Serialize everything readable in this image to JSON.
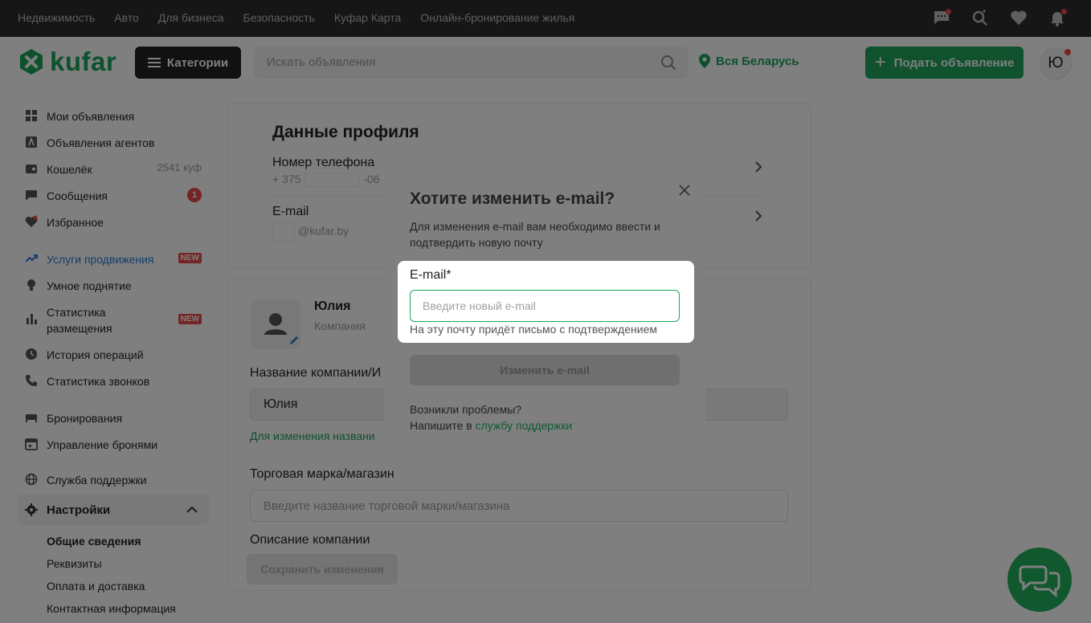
{
  "topbar": {
    "links": [
      "Недвижимость",
      "Авто",
      "Для бизнеса",
      "Безопасность",
      "Куфар Карта",
      "Онлайн-бронирование жилья"
    ]
  },
  "header": {
    "logo_text": "kufar",
    "categories_label": "Категории",
    "search_placeholder": "Искать объявления",
    "region_label": "Вся Беларусь",
    "post_button_label": "Подать объявление",
    "avatar_letter": "Ю"
  },
  "sidebar": {
    "my_ads": "Мои объявления",
    "agent_ads": "Объявления агентов",
    "wallet": "Кошелёк",
    "wallet_amount": "2541 куф",
    "messages": "Сообщения",
    "messages_count": "1",
    "favorites": "Избранное",
    "promotion": "Услуги продвижения",
    "new_badge": "NEW",
    "smart_boost": "Умное поднятие",
    "placement_stats": "Статистика размещения",
    "history": "История операций",
    "call_stats": "Статистика звонков",
    "bookings": "Бронирования",
    "booking_management": "Управление бронями",
    "support": "Служба поддержки",
    "settings": "Настройки",
    "sub": {
      "general": "Общие сведения",
      "requisites": "Реквизиты",
      "payment": "Оплата и доставка",
      "contacts": "Контактная информация"
    }
  },
  "main": {
    "profile_title": "Данные профиля",
    "phone_label": "Номер телефона",
    "phone_prefix": "+ 375",
    "phone_suffix": "-06",
    "email_label": "E-mail",
    "email_suffix": "@kufar.by",
    "company_name": "Юлия",
    "company_type": "Компания",
    "company_field_label": "Название компании/И",
    "company_field_value": "Юлия",
    "company_hint": "Для изменения названи",
    "brand_label": "Торговая марка/магазин",
    "brand_placeholder": "Введите название торговой марки/магазина",
    "description_label": "Описание компании",
    "save_label": "Сохранить изменения"
  },
  "modal": {
    "title": "Хотите изменить e-mail?",
    "description": "Для изменения e-mail вам необходимо ввести и подтвердить новую почту",
    "email_field_label": "E-mail*",
    "email_placeholder": "Введите новый e-mail",
    "email_caption": "На эту почту придёт письмо с подтверждением",
    "submit_label": "Изменить e-mail",
    "problem_text": "Возникли проблемы?",
    "write_text": "Напишите в ",
    "support_link": "службу поддержки"
  },
  "colors": {
    "brand_green": "#1aa55a",
    "badge_red": "#e94b4b",
    "topbar_bg": "#2c2c2c",
    "link_blue": "#2a7bd3"
  }
}
